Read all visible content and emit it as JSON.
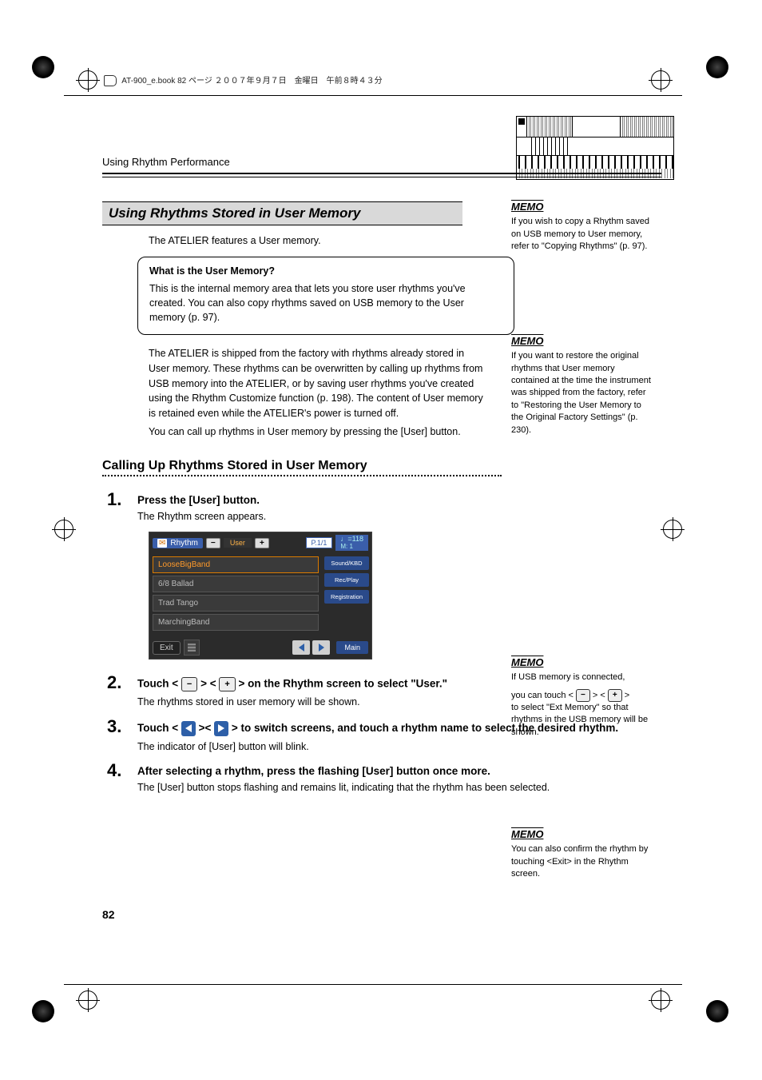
{
  "book_header": "AT-900_e.book  82 ページ  ２００７年９月７日　金曜日　午前８時４３分",
  "breadcrumb": "Using Rhythm Performance",
  "section_title": "Using Rhythms Stored in User Memory",
  "intro_text": "The ATELIER features a User memory.",
  "callout": {
    "title": "What is the User Memory?",
    "body": "This is the internal memory area that lets you store user rhythms you've created. You can also copy rhythms saved on USB memory to the User memory (p. 97)."
  },
  "body_para": "The ATELIER is shipped from the factory with rhythms already stored in User memory. These rhythms can be overwritten by calling up rhythms from USB memory into the ATELIER, or by saving user rhythms you've created using the Rhythm Customize function (p. 198). The content of User memory is retained even while the ATELIER's power is turned off.",
  "body_para2": "You can call up rhythms in User memory by pressing the [User] button.",
  "subsection_title": "Calling Up Rhythms Stored in User Memory",
  "steps": [
    {
      "num": "1.",
      "title": "Press the [User] button.",
      "body": "The Rhythm screen appears."
    },
    {
      "num": "2.",
      "title_pre": "Touch < ",
      "title_mid": " > < ",
      "title_post": " > on the Rhythm screen to select \"User.\"",
      "body": "The rhythms stored in user memory will be shown."
    },
    {
      "num": "3.",
      "title_pre": "Touch < ",
      "title_mid": " >< ",
      "title_post": " > to switch screens, and touch a rhythm name to select the desired rhythm.",
      "body": "The indicator of [User] button will blink."
    },
    {
      "num": "4.",
      "title": "After selecting a rhythm, press the flashing [User] button once more.",
      "body": "The [User] button stops flashing and remains lit, indicating that the rhythm has been selected."
    }
  ],
  "ui": {
    "title": "Rhythm",
    "minus": "−",
    "plus": "+",
    "user": "User",
    "page": "P.1/1",
    "tempo_top": "♩=118",
    "tempo_bot": "M:    1",
    "list": [
      "LooseBigBand",
      "6/8 Ballad",
      "Trad Tango",
      "MarchingBand"
    ],
    "side": [
      "Sound/KBD",
      "Rec/Play",
      "Registration"
    ],
    "exit": "Exit",
    "main": "Main"
  },
  "memos": {
    "m1": "If you wish to copy a Rhythm saved on USB memory to User memory, refer to \"Copying Rhythms\" (p. 97).",
    "m2": "If you want to restore the original rhythms that User memory contained at the time the instrument was shipped from the factory, refer to \"Restoring the User Memory to the Original Factory Settings\" (p. 230).",
    "m3_line1": "If USB memory is connected,",
    "m3_line2_pre": "you can touch < ",
    "m3_line2_mid": " > < ",
    "m3_line2_post": " >",
    "m3_line3": "to select \"Ext Memory\" so that rhythms in the USB memory will be shown.",
    "m4": "You can also confirm the rhythm by touching <Exit> in the Rhythm screen."
  },
  "page_number": "82",
  "memo_label": "MEMO"
}
